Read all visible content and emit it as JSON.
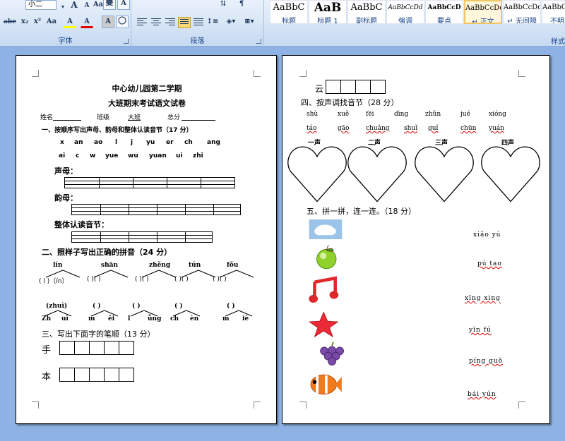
{
  "ribbon": {
    "font_group_label": "字体",
    "paragraph_group_label": "段落",
    "styles_group_label": "样式",
    "font_size": "小二",
    "font_buttons": [
      "A",
      "A",
      "Aa",
      "變",
      "A",
      "abe",
      "x₂",
      "x²",
      "Aa",
      "A",
      "A",
      "A"
    ],
    "styles": [
      {
        "sample": "AaBbC",
        "name": "标题"
      },
      {
        "sample": "AaB",
        "name": "标题 1"
      },
      {
        "sample": "AaBbC",
        "name": "副标题"
      },
      {
        "sample": "AaBbCcDd",
        "name": "强调"
      },
      {
        "sample": "AaBbCcD",
        "name": "要点"
      },
      {
        "sample": "AaBbCcDd",
        "name": "↵ 正文"
      },
      {
        "sample": "AaBbCcDd",
        "name": "↵ 无间隔"
      },
      {
        "sample": "AaBbCcDd",
        "name": "不明显"
      }
    ],
    "selected_style_index": 5
  },
  "page1": {
    "title1": "中心幼儿园第二学期",
    "title2": "大班期末考试语文试卷",
    "info_name": "姓名",
    "info_class": "班级",
    "info_class_value": "大班",
    "info_score": "总分",
    "section1_title": "一、按顺序写出声母、韵母和整体认读音节（17 分）",
    "row1": [
      "x",
      "an",
      "ao",
      "l",
      "j",
      "yu",
      "er",
      "ch",
      "ang"
    ],
    "row2": [
      "ai",
      "c",
      "w",
      "yue",
      "wu",
      "yuan",
      "ui",
      "zhi"
    ],
    "label_shengmu": "声母：",
    "label_yunmu": "韵母：",
    "label_zhengti": "整体认读音节：",
    "section2_title": "二、照样子写出正确的拼音（24 分）",
    "tree_tops": [
      "lín",
      "shān",
      "zhěng",
      "tún",
      "fǒu"
    ],
    "tree_example": "( l )（ín）",
    "tree_blank": "(    )(    )",
    "tree2_tops": [
      "(zhuì)",
      "(    )",
      "(    )",
      "(    )",
      "(    )"
    ],
    "tree2_bottom_left": [
      "Zh",
      "m",
      "l",
      "ch",
      "m"
    ],
    "tree2_bottom_right": [
      "uì",
      "ěi",
      "ǚng",
      "èn",
      "iè"
    ],
    "section3_title": "三、写出下面字的笔顺（13 分）",
    "char1": "手",
    "char2": "本"
  },
  "page2": {
    "char_yun": "云",
    "section4_title": "四、按声调找音节（28 分）",
    "row1": [
      "shù",
      "xuě",
      "fēi",
      "dìng",
      "zhǔn",
      "jué",
      "xióng"
    ],
    "row2": [
      "táo",
      "gāo",
      "chuǎng",
      "shuǐ",
      "guǐ",
      "chūn",
      "yuán"
    ],
    "tones": [
      "一声",
      "二声",
      "三声",
      "四声"
    ],
    "section5_title": "五、拼一拼，连一连。（18 分）",
    "pinyin_list": [
      "xiǎo yú",
      "pú tao",
      "xīng xing",
      "yīn fú",
      "píng guǒ",
      "bái yún"
    ],
    "pictures": [
      "cloud-picture",
      "apple-picture",
      "music-note-picture",
      "star-picture",
      "grape-picture",
      "fish-picture"
    ]
  }
}
